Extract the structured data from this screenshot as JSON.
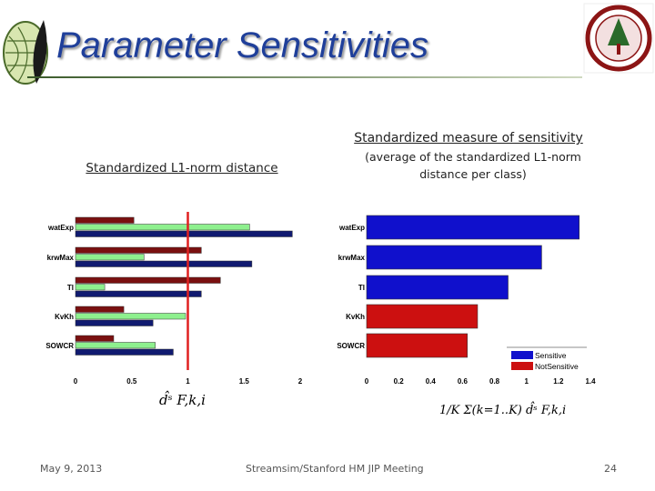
{
  "slide": {
    "title": "Parameter Sensitivities",
    "left_heading": "Standardized L1-norm distance",
    "right_heading": "Standardized measure of sensitivity",
    "right_subheading_1": "(average of the standardized L1-norm",
    "right_subheading_2": "distance per class)",
    "footer_date": "May 9, 2013",
    "footer_center": "Streamsim/Stanford HM JIP Meeting",
    "page_number": "24",
    "left_logo": "leaf-globe-logo",
    "right_logo": "stanford-seal-logo"
  },
  "chart_data": [
    {
      "type": "bar",
      "orientation": "horizontal",
      "categories": [
        "watExp",
        "krwMax",
        "TI",
        "KvKh",
        "SOWCR"
      ],
      "series": [
        {
          "color": "#7a1010",
          "values": [
            0.52,
            1.12,
            1.29,
            0.43,
            0.34
          ]
        },
        {
          "color": "#8ef08e",
          "values": [
            1.55,
            0.61,
            0.26,
            0.98,
            0.71
          ]
        },
        {
          "color": "#101a70",
          "values": [
            1.93,
            1.57,
            1.12,
            0.69,
            0.87
          ]
        }
      ],
      "xlabel": "d̂ˢ F,k,i",
      "xlim": [
        0,
        2
      ],
      "xticks": [
        "0",
        "0.5",
        "1",
        "1.5",
        "2"
      ],
      "reference_line": {
        "x": 1,
        "color": "#e02020"
      }
    },
    {
      "type": "bar",
      "orientation": "horizontal",
      "categories": [
        "watExp",
        "krwMax",
        "TI",
        "KvKh",
        "SOWCR"
      ],
      "values": [
        1.33,
        1.095,
        0.885,
        0.694,
        0.63
      ],
      "classes": [
        "Sensitive",
        "Sensitive",
        "Sensitive",
        "NotSensitive",
        "NotSensitive"
      ],
      "legend": [
        {
          "name": "Sensitive",
          "color": "#1010cc"
        },
        {
          "name": "NotSensitive",
          "color": "#cc1010"
        }
      ],
      "legend_position": "bottom-right",
      "xlabel": "1/K Σ(k=1..K) d̂ˢ F,k,i",
      "xlim": [
        0,
        1.4
      ],
      "xticks": [
        "0",
        "0.2",
        "0.4",
        "0.6",
        "0.8",
        "1",
        "1.2",
        "1.4"
      ]
    }
  ]
}
